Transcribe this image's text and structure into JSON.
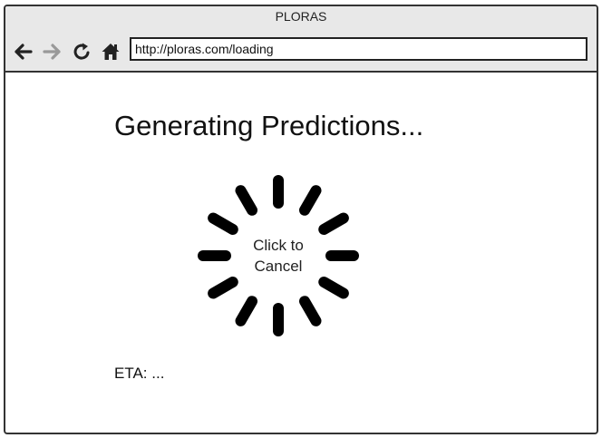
{
  "window": {
    "title": "PLORAS"
  },
  "toolbar": {
    "back_icon": "arrow-left-icon",
    "forward_icon": "arrow-right-icon",
    "reload_icon": "reload-icon",
    "home_icon": "home-icon",
    "address_value": "http://ploras.com/loading"
  },
  "main": {
    "heading": "Generating Predictions...",
    "spinner_icon": "loading-spinner-icon",
    "cancel_label": "Click to\nCancel",
    "eta_text": "ETA: ..."
  },
  "colors": {
    "icon_active": "#222222",
    "icon_disabled": "#999999",
    "chrome_bg": "#e8e8e8"
  }
}
